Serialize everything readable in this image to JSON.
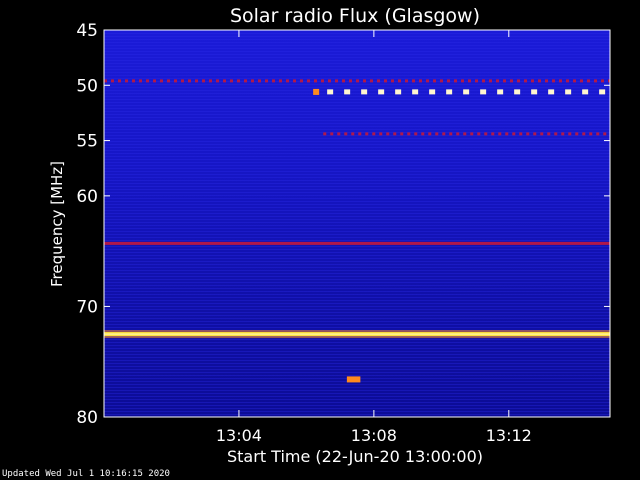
{
  "chart_data": {
    "type": "heatmap",
    "title": "Solar radio Flux (Glasgow)",
    "xlabel": "Start Time (22-Jun-20 13:00:00)",
    "ylabel": "Frequency [MHz]",
    "xlim_minutes": [
      0,
      15
    ],
    "ylim_mhz": [
      45,
      80
    ],
    "y_ticks": [
      {
        "value": 45,
        "label": "45"
      },
      {
        "value": 50,
        "label": "50"
      },
      {
        "value": 55,
        "label": "55"
      },
      {
        "value": 60,
        "label": "60"
      },
      {
        "value": 70,
        "label": "70"
      },
      {
        "value": 80,
        "label": "80"
      }
    ],
    "x_ticks": [
      {
        "minute": 4,
        "label": "13:04"
      },
      {
        "minute": 8,
        "label": "13:08"
      },
      {
        "minute": 12,
        "label": "13:12"
      }
    ],
    "colors": {
      "background_high": "#1a1ad8",
      "background_mid": "#1212b8",
      "background_low": "#0b0b8c",
      "interference_red": "#b0184a",
      "interference_orange": "#ff8a1e",
      "interference_white": "#fff6d0",
      "strong_band": "#ffe23a"
    },
    "interference_bands": [
      {
        "freq_mhz": 49.6,
        "start_min": 0,
        "end_min": 15,
        "kind": "dotted-red"
      },
      {
        "freq_mhz": 50.6,
        "start_min": 6.2,
        "end_min": 15,
        "kind": "dotted-white"
      },
      {
        "freq_mhz": 54.4,
        "start_min": 6.5,
        "end_min": 15,
        "kind": "dotted-red"
      },
      {
        "freq_mhz": 64.3,
        "start_min": 0,
        "end_min": 15,
        "kind": "solid-red"
      },
      {
        "freq_mhz": 72.5,
        "start_min": 0,
        "end_min": 15,
        "kind": "solid-yellow"
      },
      {
        "freq_mhz": 76.6,
        "start_min": 7.2,
        "end_min": 7.6,
        "kind": "burst-orange"
      }
    ]
  },
  "footer": {
    "updated": "Updated Wed Jul  1 10:16:15 2020"
  }
}
